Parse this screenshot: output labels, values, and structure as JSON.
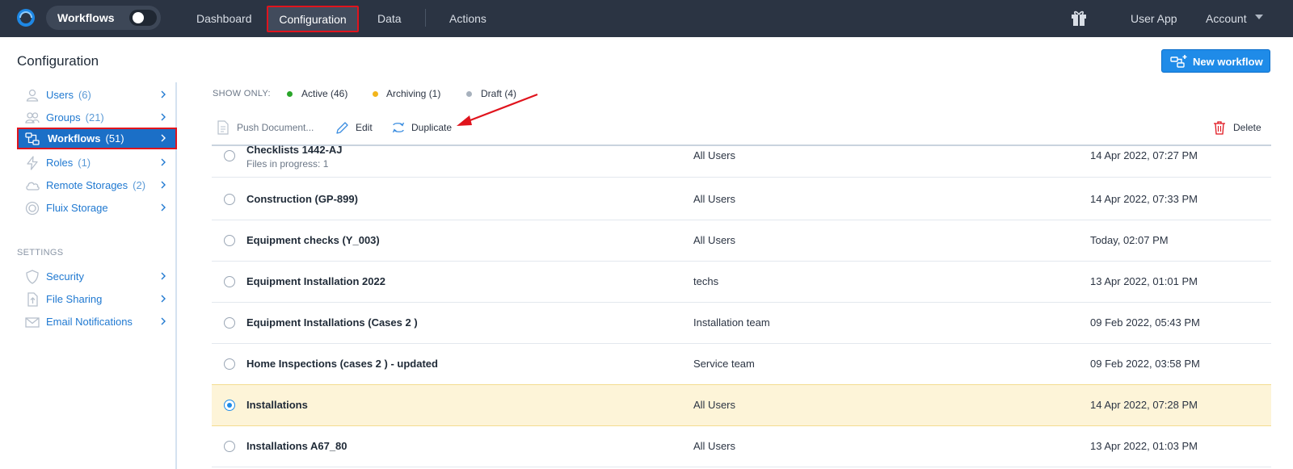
{
  "topbar": {
    "mode_label": "Workflows",
    "nav": [
      "Dashboard",
      "Configuration",
      "Data",
      "Actions"
    ],
    "active_nav": "Configuration",
    "user_app": "User App",
    "account": "Account"
  },
  "header": {
    "title": "Configuration",
    "new_workflow": "New workflow"
  },
  "sidebar": {
    "items": [
      {
        "label": "Users",
        "count": "(6)",
        "icon": "user-icon"
      },
      {
        "label": "Groups",
        "count": "(21)",
        "icon": "group-icon"
      },
      {
        "label": "Workflows",
        "count": "(51)",
        "icon": "workflow-icon",
        "active": true
      },
      {
        "label": "Roles",
        "count": "(1)",
        "icon": "lightning-icon"
      },
      {
        "label": "Remote Storages",
        "count": "(2)",
        "icon": "cloud-icon"
      },
      {
        "label": "Fluix Storage",
        "count": "",
        "icon": "fluix-storage-icon"
      }
    ],
    "settings_heading": "SETTINGS",
    "settings": [
      {
        "label": "Security",
        "icon": "shield-icon"
      },
      {
        "label": "File Sharing",
        "icon": "file-share-icon"
      },
      {
        "label": "Email Notifications",
        "icon": "envelope-icon"
      }
    ]
  },
  "filters": {
    "label": "SHOW ONLY:",
    "items": [
      {
        "label": "Active (46)",
        "color": "#2aa52a"
      },
      {
        "label": "Archiving (1)",
        "color": "#f2b51c"
      },
      {
        "label": "Draft (4)",
        "color": "#a7b1bd"
      }
    ]
  },
  "toolbar": {
    "push": "Push Document...",
    "edit": "Edit",
    "duplicate": "Duplicate",
    "delete": "Delete"
  },
  "rows": [
    {
      "name": "Checklists 1442-AJ",
      "sub": "Files in progress: 1",
      "group": "All Users",
      "date": "14 Apr 2022, 07:27 PM",
      "selected": false
    },
    {
      "name": "Construction (GP-899)",
      "sub": "",
      "group": "All Users",
      "date": "14 Apr 2022, 07:33 PM",
      "selected": false
    },
    {
      "name": "Equipment checks (Y_003)",
      "sub": "",
      "group": "All Users",
      "date": "Today, 02:07 PM",
      "selected": false
    },
    {
      "name": "Equipment Installation 2022",
      "sub": "",
      "group": "techs",
      "date": "13 Apr 2022, 01:01 PM",
      "selected": false
    },
    {
      "name": "Equipment Installations (Cases 2 )",
      "sub": "",
      "group": "Installation team",
      "date": "09 Feb 2022, 05:43 PM",
      "selected": false
    },
    {
      "name": "Home Inspections (cases 2 ) - updated",
      "sub": "",
      "group": "Service team",
      "date": "09 Feb 2022, 03:58 PM",
      "selected": false
    },
    {
      "name": "Installations",
      "sub": "",
      "group": "All Users",
      "date": "14 Apr 2022, 07:28 PM",
      "selected": true
    },
    {
      "name": "Installations A67_80",
      "sub": "",
      "group": "All Users",
      "date": "13 Apr 2022, 01:03 PM",
      "selected": false
    }
  ],
  "colors": {
    "topbar": "#2b3443",
    "accent": "#1f8be8",
    "highlight": "#e0141d",
    "selected_row": "#fdf4d8"
  }
}
